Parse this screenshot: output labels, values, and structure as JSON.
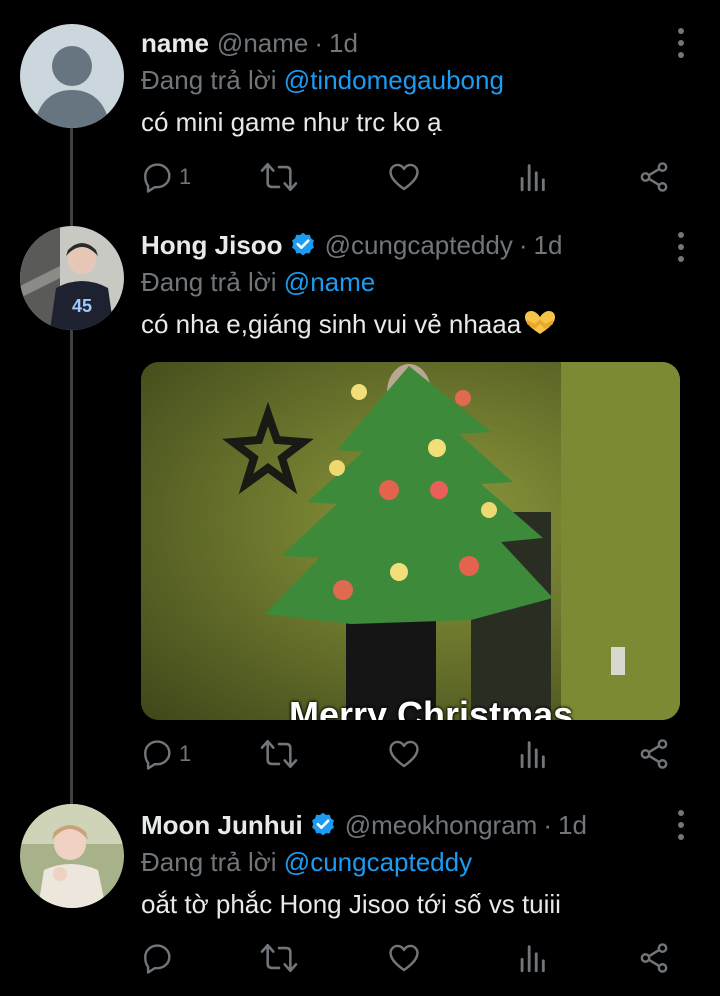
{
  "tweets": [
    {
      "display_name": "name",
      "handle": "@name",
      "time": "1d",
      "replying_prefix": "Đang trả lời",
      "replying_to": "@tindomegaubong",
      "text": "có mini game như trc ko ạ",
      "reply_count": "1",
      "retweet_count": "",
      "like_count": "",
      "verified": false
    },
    {
      "display_name": "Hong Jisoo",
      "handle": "@cungcapteddy",
      "time": "1d",
      "replying_prefix": "Đang trả lời",
      "replying_to": "@name",
      "text": "có nha e,giáng sinh vui vẻ nhaaa",
      "reply_count": "1",
      "verified": true,
      "media_caption": "Merry Christmas"
    },
    {
      "display_name": "Moon Junhui",
      "handle": "@meokhongram",
      "time": "1d",
      "replying_prefix": "Đang trả lời",
      "replying_to": "@cungcapteddy",
      "text": "oắt tờ phắc Hong Jisoo tới số vs tuiii",
      "reply_count": "",
      "verified": true
    }
  ],
  "separator": "·",
  "colors": {
    "background": "#000000",
    "accent": "#1d9bf0",
    "muted": "#71767b",
    "text": "#e7e9ea"
  },
  "icons": [
    "reply-icon",
    "retweet-icon",
    "like-icon",
    "analytics-icon",
    "share-icon",
    "more-icon",
    "verified-badge-icon",
    "heart-hands-emoji"
  ]
}
